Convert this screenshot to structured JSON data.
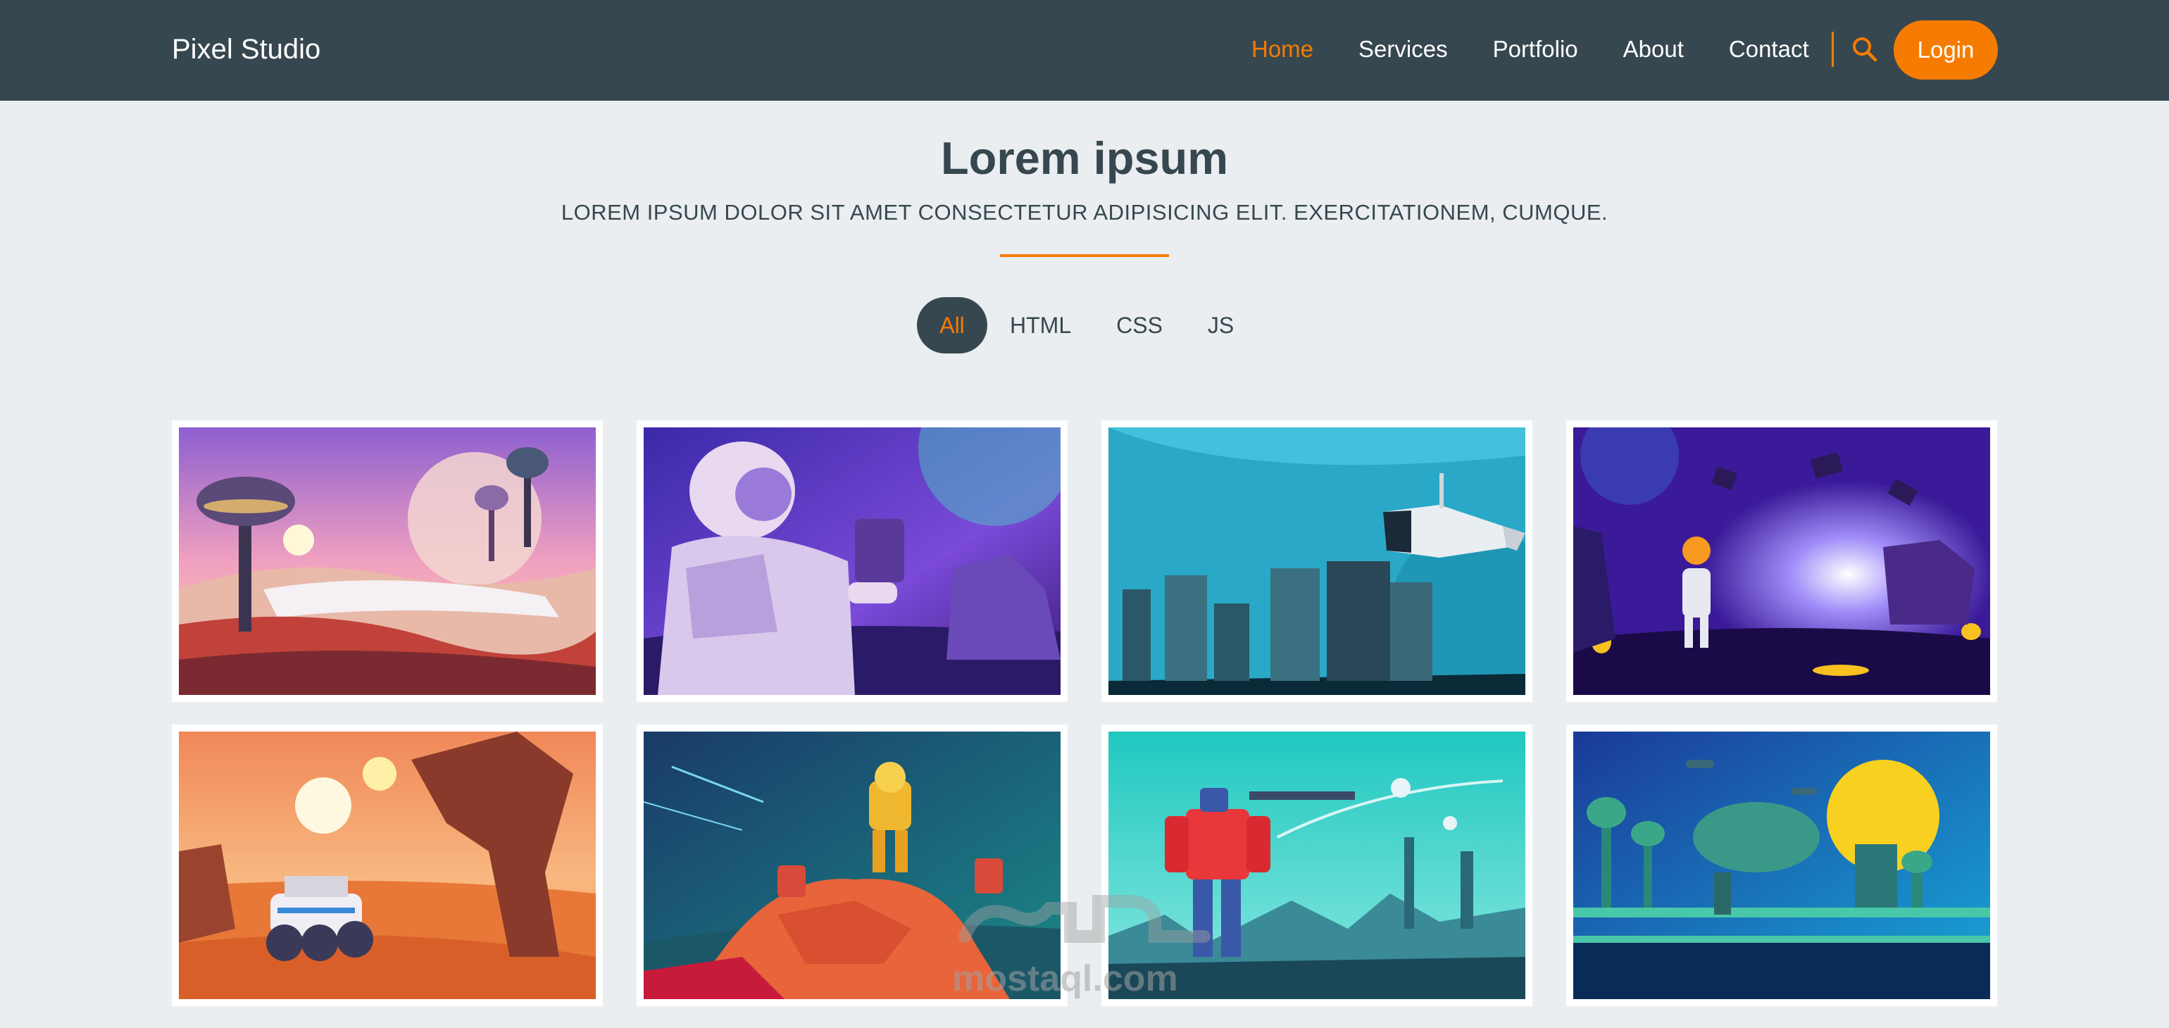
{
  "navbar": {
    "brand": "Pixel Studio",
    "links": [
      {
        "label": "Home",
        "active": true
      },
      {
        "label": "Services",
        "active": false
      },
      {
        "label": "Portfolio",
        "active": false
      },
      {
        "label": "About",
        "active": false
      },
      {
        "label": "Contact",
        "active": false
      }
    ],
    "search_icon": "search-icon",
    "login_label": "Login"
  },
  "header": {
    "title": "Lorem ipsum",
    "subtitle": "LOREM IPSUM DOLOR SIT AMET CONSECTETUR ADIPISICING ELIT. EXERCITATIONEM, CUMQUE."
  },
  "filters": [
    {
      "label": "All",
      "active": true
    },
    {
      "label": "HTML",
      "active": false
    },
    {
      "label": "CSS",
      "active": false
    },
    {
      "label": "JS",
      "active": false
    }
  ],
  "gallery": {
    "items": [
      {
        "scene": "alien mushroom planet"
      },
      {
        "scene": "astronaut on purple planet"
      },
      {
        "scene": "spaceship over ruins"
      },
      {
        "scene": "astronaut among floating rocks"
      },
      {
        "scene": "rover on desert planet"
      },
      {
        "scene": "mech robots on rocks"
      },
      {
        "scene": "red robot and drones"
      },
      {
        "scene": "futuristic city with robot"
      }
    ]
  },
  "watermark": "mostaql.com",
  "colors": {
    "navbar": "#37474f",
    "accent": "#f57c00",
    "background": "#eaeef1",
    "text": "#37474f"
  }
}
